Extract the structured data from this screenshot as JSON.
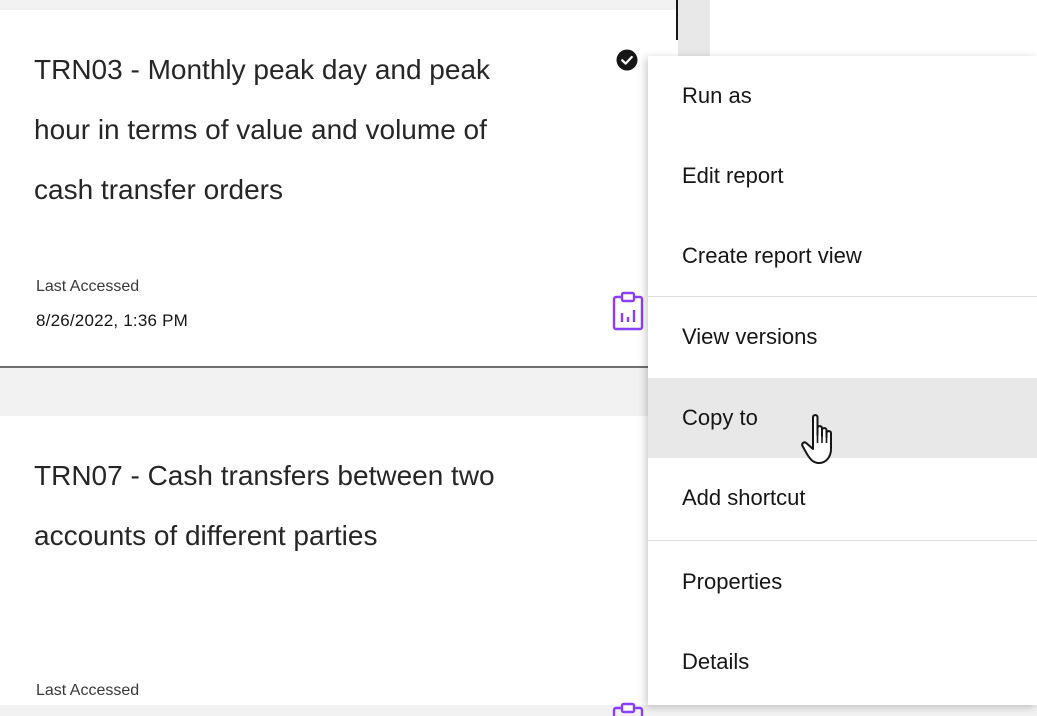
{
  "cards": [
    {
      "title": "TRN03 - Monthly peak day and peak hour in terms of value and volume of cash transfer orders",
      "last_accessed_label": "Last Accessed",
      "last_accessed_value": "8/26/2022, 1:36 PM",
      "status_icon": "checkmark-filled-icon",
      "type_icon": "report-clipboard-icon"
    },
    {
      "title": "TRN07 - Cash transfers between two accounts of different parties",
      "last_accessed_label": "Last Accessed",
      "type_icon": "report-clipboard-icon"
    }
  ],
  "menu": {
    "items": [
      {
        "label": "Run as"
      },
      {
        "label": "Edit report"
      },
      {
        "label": "Create report view"
      },
      {
        "label": "View versions"
      },
      {
        "label": "Copy to",
        "hovered": true
      },
      {
        "label": "Add shortcut"
      },
      {
        "label": "Properties"
      },
      {
        "label": "Details"
      }
    ]
  },
  "colors": {
    "accent_purple": "#8a3ffc",
    "hover_bg": "#e8e8e8",
    "background": "#f2f2f2"
  },
  "cursor_icon": "hand-pointer-icon"
}
